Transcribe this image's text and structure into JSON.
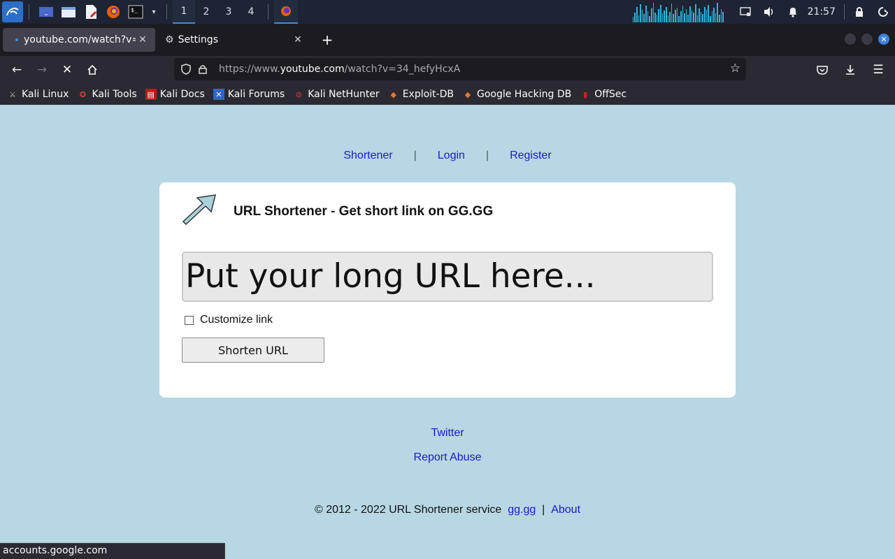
{
  "taskbar": {
    "workspaces": [
      "1",
      "2",
      "3",
      "4"
    ],
    "clock": "21:57",
    "accent": "#3d8de0"
  },
  "browser": {
    "tabs": [
      {
        "title": "youtube.com/watch?v=34_hefyHcxA",
        "active": true
      },
      {
        "title": "Settings",
        "active": false
      }
    ],
    "url": {
      "prefix": "https://www.",
      "domain": "youtube.com",
      "path": "/watch?v=34_hefyHcxA"
    },
    "bookmarks": [
      "Kali Linux",
      "Kali Tools",
      "Kali Docs",
      "Kali Forums",
      "Kali NetHunter",
      "Exploit-DB",
      "Google Hacking DB",
      "OffSec"
    ],
    "status": "accounts.google.com"
  },
  "page": {
    "nav": {
      "shortener": "Shortener",
      "sep": "|",
      "login": "Login",
      "register": "Register"
    },
    "title": "URL Shortener - Get short link on GG.GG",
    "input_placeholder": "Put your long URL here...",
    "customize_label": "Customize link",
    "shorten_button": "Shorten URL",
    "twitter": "Twitter",
    "report_abuse": "Report Abuse",
    "copyright": {
      "text": "© 2012 - 2022 URL Shortener service",
      "link": "gg.gg",
      "sep": "|",
      "about": "About"
    },
    "colors": {
      "background": "#b7d7e4",
      "link": "#1a1ac8"
    }
  }
}
